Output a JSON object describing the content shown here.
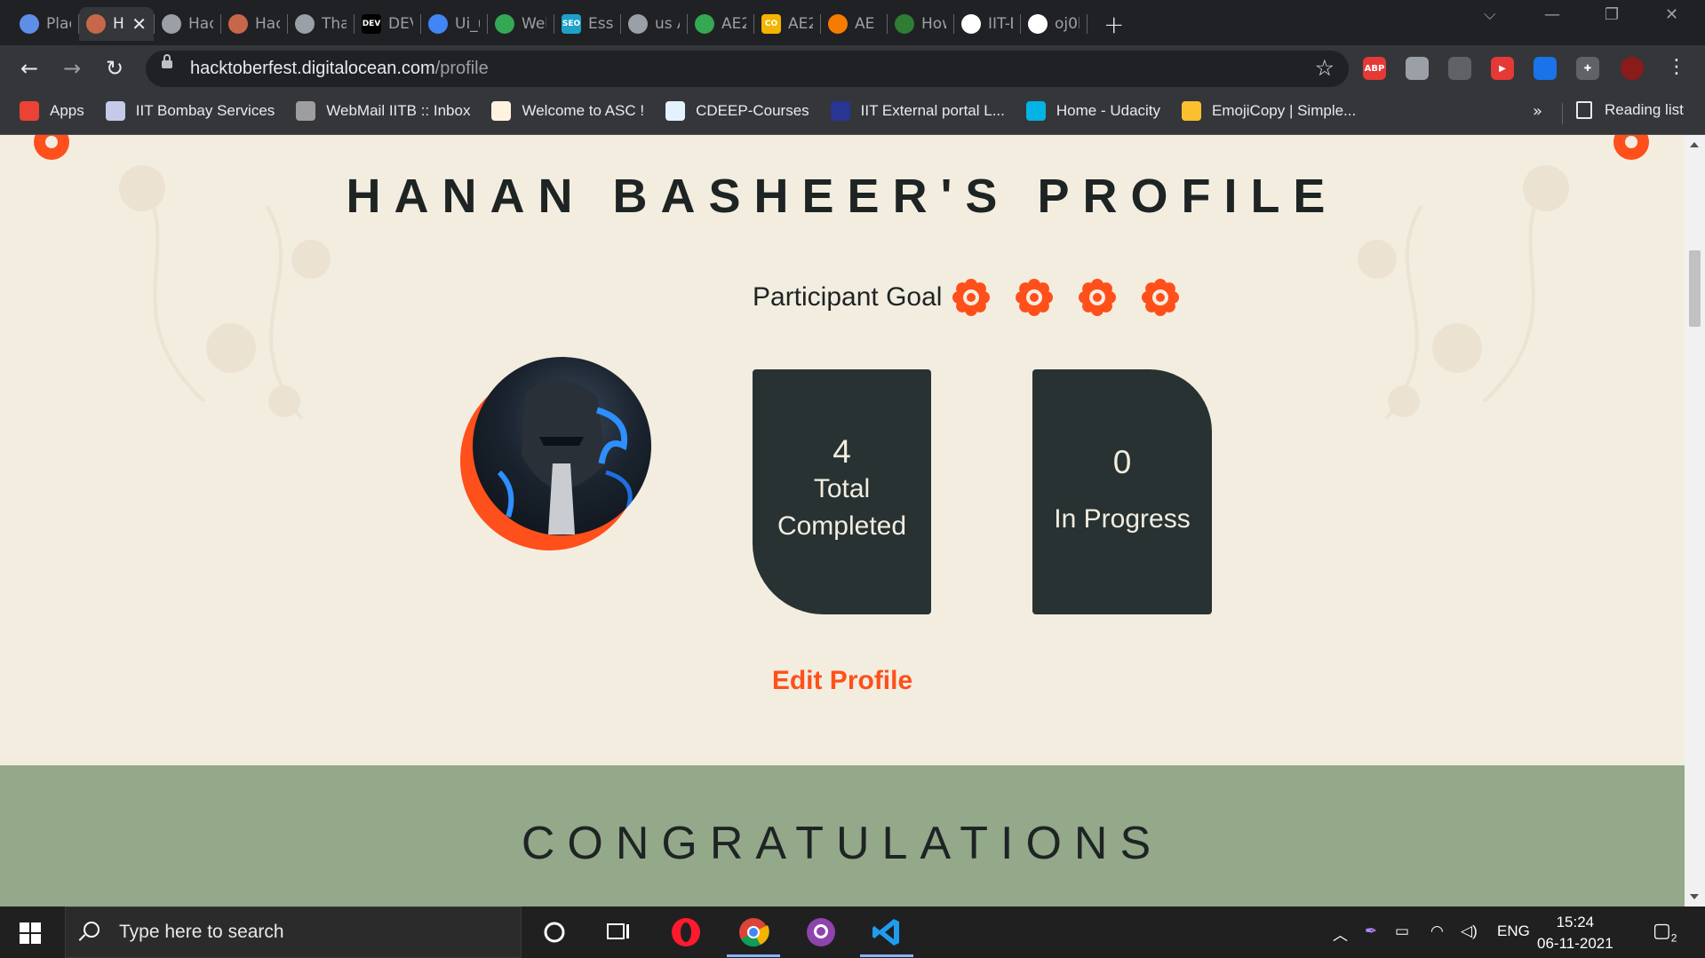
{
  "browser": {
    "tabs": [
      {
        "title": "Plac",
        "icon": "settings-gear-favicon",
        "color": "#5f8ee8"
      },
      {
        "title": "H",
        "icon": "hacktoberfest-favicon",
        "color": "#c7674a",
        "active": true
      },
      {
        "title": "Hacl",
        "icon": "globe-icon",
        "color": "#9aa0a6"
      },
      {
        "title": "Hacl",
        "icon": "hacktoberfest-favicon",
        "color": "#c7674a"
      },
      {
        "title": "Thar",
        "icon": "globe-icon",
        "color": "#9aa0a6"
      },
      {
        "title": "DEV",
        "icon": "dev-favicon",
        "color": "#000000",
        "badge": "DEV"
      },
      {
        "title": "Ui_u",
        "icon": "google-docs-favicon",
        "color": "#4285f4"
      },
      {
        "title": "Web",
        "icon": "google-drive-favicon",
        "color": "#34a853"
      },
      {
        "title": "Essa",
        "icon": "seo-favicon",
        "color": "#1da1c9",
        "badge": "SEO"
      },
      {
        "title": "us A",
        "icon": "globe-icon",
        "color": "#9aa0a6"
      },
      {
        "title": "AE2",
        "icon": "google-drive-favicon",
        "color": "#34a853"
      },
      {
        "title": "AE2",
        "icon": "coursera-favicon",
        "color": "#f4b400",
        "badge": "CO"
      },
      {
        "title": "AE 2",
        "icon": "chart-favicon",
        "color": "#f57c00"
      },
      {
        "title": "How",
        "icon": "link-favicon",
        "color": "#2e7d32"
      },
      {
        "title": "IIT-B",
        "icon": "github-favicon",
        "color": "#ffffff"
      },
      {
        "title": "oj0h",
        "icon": "google-favicon",
        "color": "#ffffff"
      }
    ],
    "window_controls": {
      "tab_search": "⌵",
      "minimize": "—",
      "restore": "❐",
      "close": "✕"
    },
    "url": {
      "domain": "hacktoberfest.digitalocean.com",
      "path": "/profile"
    },
    "extensions": [
      {
        "name": "adblock-plus-icon",
        "label": "ABP",
        "color": "#e53935"
      },
      {
        "name": "extension-icon",
        "label": "",
        "color": "#9aa0a6"
      },
      {
        "name": "camera-extension-icon",
        "label": "",
        "color": "#5f6368"
      },
      {
        "name": "youtube-extension-icon",
        "label": "▶",
        "color": "#e53935"
      },
      {
        "name": "screen-recorder-icon",
        "label": "",
        "color": "#1a73e8"
      },
      {
        "name": "puzzle-icon",
        "label": "✚",
        "color": "#5f6368"
      }
    ],
    "bookmarks": [
      {
        "label": "Apps",
        "color": "#ea4335"
      },
      {
        "label": "IIT Bombay Services",
        "color": "#c5cae9"
      },
      {
        "label": "WebMail IITB :: Inbox",
        "color": "#9e9e9e"
      },
      {
        "label": "Welcome to ASC !",
        "color": "#fff3e0"
      },
      {
        "label": "CDEEP-Courses",
        "color": "#e3f2fd"
      },
      {
        "label": "IIT External portal L...",
        "color": "#283593"
      },
      {
        "label": "Home - Udacity",
        "color": "#02b3e4"
      },
      {
        "label": "EmojiCopy | Simple...",
        "color": "#fbc02d"
      }
    ],
    "bookmarks_overflow": "»",
    "reading_list": "Reading list"
  },
  "page": {
    "title": "HANAN BASHEER'S PROFILE",
    "goal_label": "Participant Goal",
    "goal_completed": 4,
    "goal_total": 4,
    "stats": [
      {
        "value": "4",
        "label_line1": "Total",
        "label_line2": "Completed"
      },
      {
        "value": "0",
        "label_line1": "In Progress",
        "label_line2": ""
      }
    ],
    "edit_profile": "Edit Profile",
    "congrats": "CONGRATULATIONS",
    "colors": {
      "accent": "#ff4f1a",
      "card": "#283232",
      "background": "#f3ede0",
      "band": "#93a98a",
      "text": "#1e2424"
    }
  },
  "taskbar": {
    "search_placeholder": "Type here to search",
    "pinned": [
      "cortana-icon",
      "task-view-icon",
      "opera-icon",
      "chrome-icon",
      "github-desktop-icon",
      "vscode-icon"
    ],
    "language": "ENG",
    "time": "15:24",
    "date": "06-11-2021",
    "notifications": "2"
  }
}
